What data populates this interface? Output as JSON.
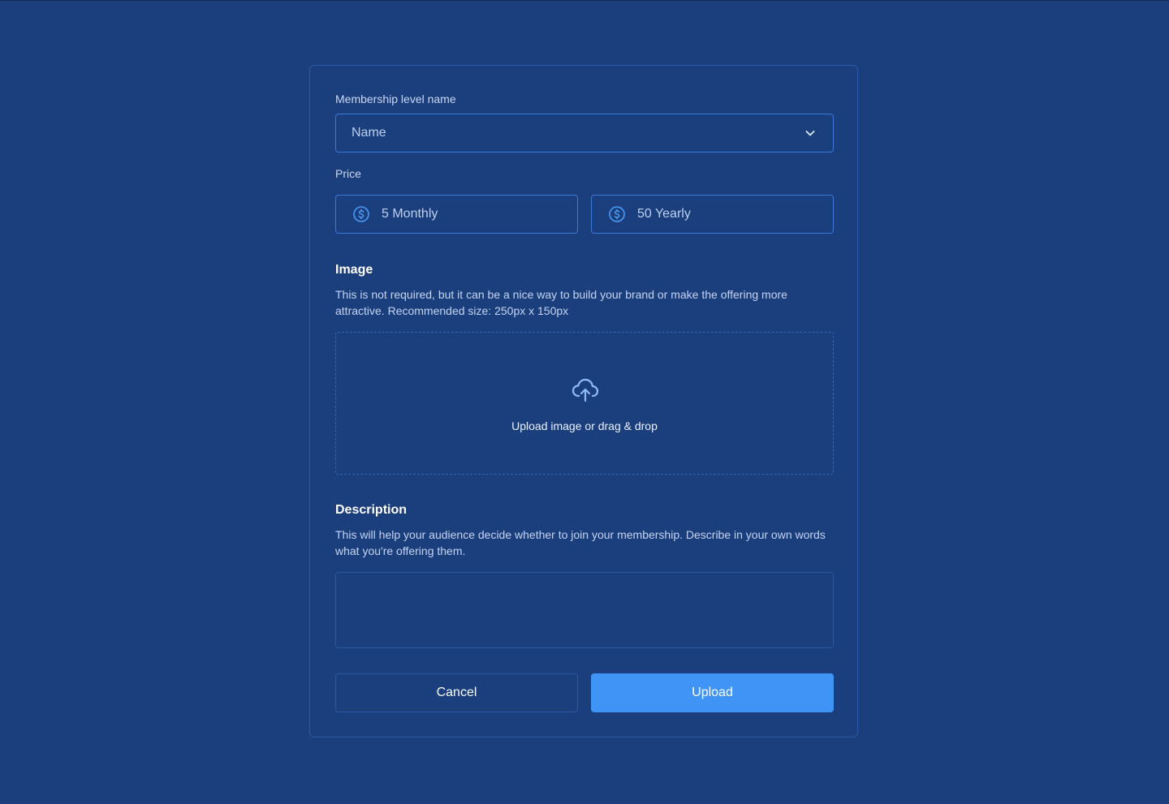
{
  "form": {
    "membership_label": "Membership level name",
    "membership_value": "Name",
    "price_label": "Price",
    "price_monthly": "5 Monthly",
    "price_yearly": "50 Yearly",
    "image_title": "Image",
    "image_desc": "This is not required, but it can be a nice way to build your brand or make the offering more attractive. Recommended size: 250px x 150px",
    "upload_hint": "Upload image or drag & drop",
    "description_title": "Description",
    "description_desc": "This will help your audience decide whether to join your membership. Describe in your own words what you're offering them.",
    "description_value": "",
    "cancel_label": "Cancel",
    "upload_label": "Upload"
  },
  "icons": {
    "select": "chevron-down-icon",
    "price": "dollar-circle-icon",
    "upload": "cloud-upload-icon"
  },
  "colors": {
    "background": "#1b3e7c",
    "accent": "#3f94f5",
    "border": "#3a78d6"
  }
}
